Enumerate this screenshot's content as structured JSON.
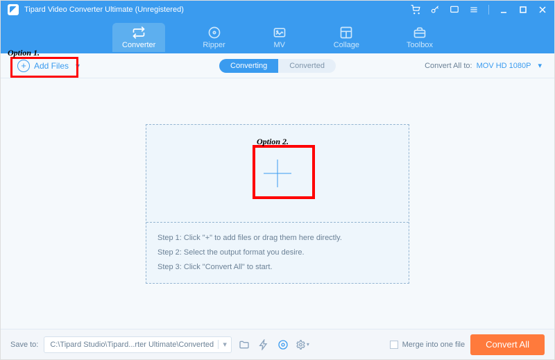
{
  "titlebar": {
    "title": "Tipard Video Converter Ultimate (Unregistered)"
  },
  "menu": {
    "converter": "Converter",
    "ripper": "Ripper",
    "mv": "MV",
    "collage": "Collage",
    "toolbox": "Toolbox"
  },
  "subbar": {
    "add_files": "Add Files",
    "tab_converting": "Converting",
    "tab_converted": "Converted",
    "convert_all_to": "Convert All to:",
    "format": "MOV HD 1080P"
  },
  "steps": {
    "s1": "Step 1: Click \"+\" to add files or drag them here directly.",
    "s2": "Step 2: Select the output format you desire.",
    "s3": "Step 3: Click \"Convert All\" to start."
  },
  "footer": {
    "save_to_label": "Save to:",
    "save_path": "C:\\Tipard Studio\\Tipard...rter Ultimate\\Converted",
    "merge_label": "Merge into one file",
    "convert_all_btn": "Convert All"
  },
  "annotations": {
    "opt1": "Option 1.",
    "opt2": "Option 2."
  }
}
